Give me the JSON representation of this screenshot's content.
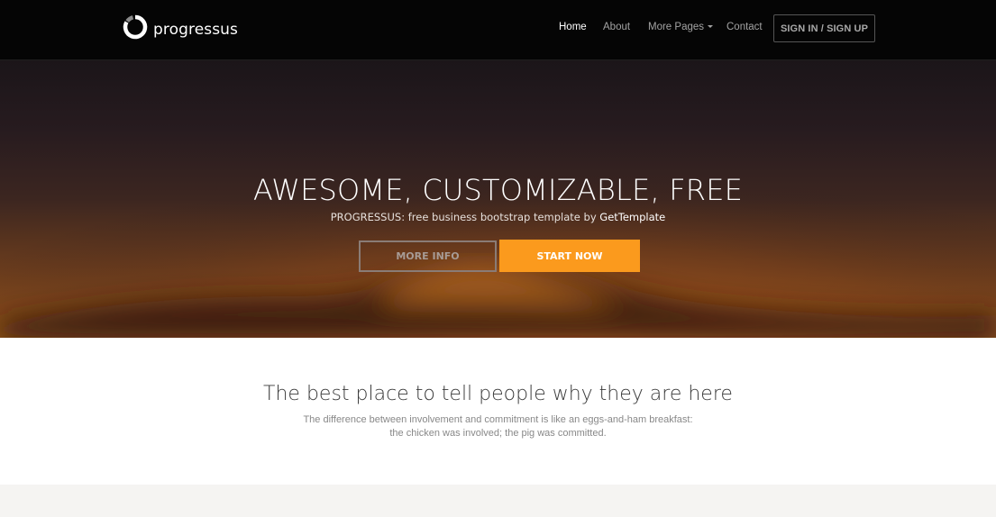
{
  "brand": {
    "name": "progressus",
    "logo_icon": "progress-ring-icon"
  },
  "nav": {
    "home": "Home",
    "about": "About",
    "more_pages": "More Pages",
    "contact": "Contact",
    "signin": "SIGN IN / SIGN UP"
  },
  "hero": {
    "title": "AWESOME, CUSTOMIZABLE, FREE",
    "subtitle_prefix": "PROGRESSUS: free business bootstrap template by ",
    "subtitle_author": "GetTemplate",
    "more_info": "MORE INFO",
    "start_now": "START NOW"
  },
  "intro": {
    "title": "The best place to tell people why they are here",
    "line1": "The difference between involvement and commitment is like an eggs-and-ham breakfast:",
    "line2": "the chicken was involved; the pig was committed."
  },
  "colors": {
    "navbar_bg": "#050505",
    "accent": "#fb9a1d",
    "footer_band": "#f5f4f2"
  }
}
